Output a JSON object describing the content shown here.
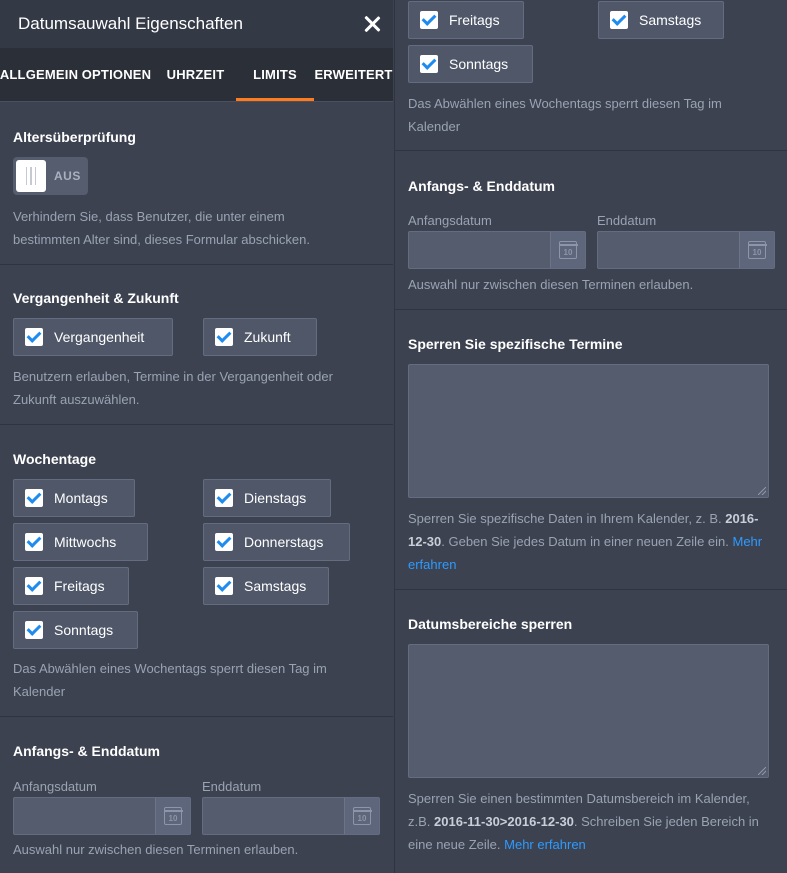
{
  "header": {
    "title": "Datumsauwahl Eigenschaften"
  },
  "tabs": [
    {
      "label": "ALLGEMEIN"
    },
    {
      "label": "OPTIONEN"
    },
    {
      "label": "UHRZEIT"
    },
    {
      "label": "LIMITS",
      "active": true
    },
    {
      "label": "ERWEITERT"
    }
  ],
  "age_check": {
    "title": "Altersüberprüfung",
    "toggle_state": "AUS",
    "help": "Verhindern Sie, dass Benutzer, die unter einem bestimmten Alter sind, dieses Formular abschicken."
  },
  "past_future": {
    "title": "Vergangenheit & Zukunft",
    "options": [
      {
        "label": "Vergangenheit",
        "checked": true
      },
      {
        "label": "Zukunft",
        "checked": true
      }
    ],
    "help": "Benutzern erlauben, Termine in der Vergangenheit oder Zukunft auszuwählen."
  },
  "weekdays": {
    "title": "Wochentage",
    "options": [
      {
        "label": "Montags",
        "checked": true
      },
      {
        "label": "Dienstags",
        "checked": true
      },
      {
        "label": "Mittwochs",
        "checked": true
      },
      {
        "label": "Donnerstags",
        "checked": true
      },
      {
        "label": "Freitags",
        "checked": true
      },
      {
        "label": "Samstags",
        "checked": true
      },
      {
        "label": "Sonntags",
        "checked": true
      }
    ],
    "help": "Das Abwählen eines Wochentags sperrt diesen Tag im Kalender"
  },
  "date_range": {
    "title": "Anfangs- & Enddatum",
    "start_label": "Anfangsdatum",
    "end_label": "Enddatum",
    "start_value": "",
    "end_value": "",
    "calendar_day": "10",
    "help": "Auswahl nur zwischen diesen Terminen erlauben."
  },
  "block_dates": {
    "title": "Sperren Sie spezifische Termine",
    "value": "",
    "help_prefix": "Sperren Sie spezifische Daten in Ihrem Kalender, z. B.",
    "help_example": "2016-12-30",
    "help_suffix": ". Geben Sie jedes Datum in einer neuen Zeile ein.",
    "link": "Mehr erfahren"
  },
  "block_ranges": {
    "title": "Datumsbereiche sperren",
    "value": "",
    "help_prefix": "Sperren Sie einen bestimmten Datumsbereich im Kalender, z.B.",
    "help_example": "2016-11-30>2016-12-30",
    "help_suffix": ". Schreiben Sie jeden Bereich in eine neue Zeile.",
    "link": "Mehr erfahren"
  },
  "colors": {
    "accent": "#ff7b1c",
    "check": "#1e8bef",
    "link": "#2e9bff",
    "panel": "#3c4250"
  }
}
